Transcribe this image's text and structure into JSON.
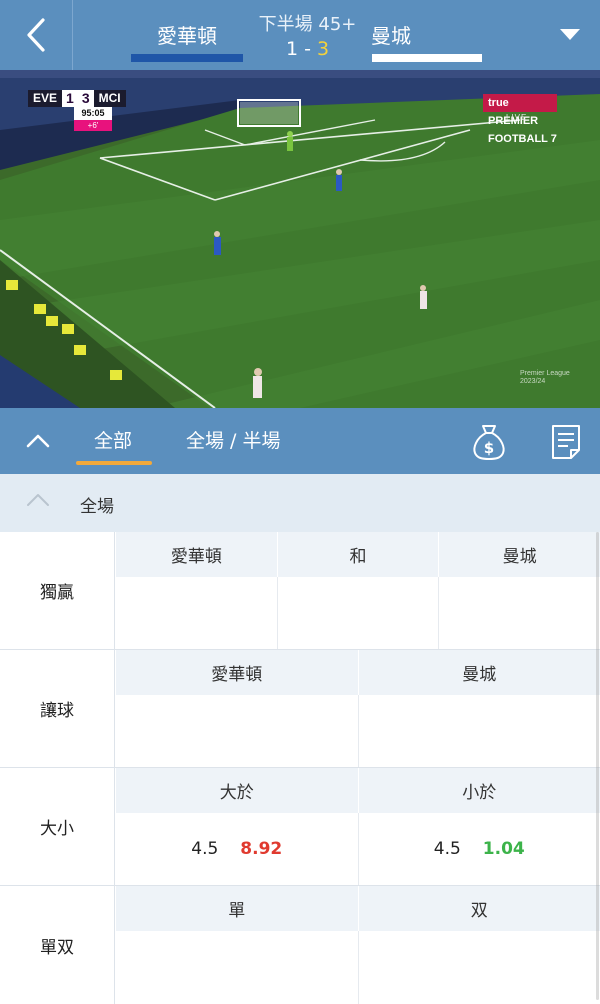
{
  "header": {
    "home_team": "愛華頓",
    "away_team": "曼城",
    "period": "下半場 45+",
    "home_score": "1",
    "score_sep": " - ",
    "away_score": "3",
    "home_color": "#1f56a8",
    "away_color": "#ffffff"
  },
  "video": {
    "home_abbr": "EVE",
    "away_abbr": "MCI",
    "home_goals": "1",
    "away_goals": "3",
    "clock": "95:05",
    "added_time": "+6'",
    "broadcaster": "true PREMIER FOOTBALL 7",
    "live": "LIVE",
    "watermark_line1": "Premier League",
    "watermark_line2": "2023/24"
  },
  "tabs": {
    "all": "全部",
    "full_half": "全場 / 半場",
    "active": "all"
  },
  "section": {
    "title": "全場"
  },
  "markets": [
    {
      "label": "獨贏",
      "headers": [
        "愛華頓",
        "和",
        "曼城"
      ],
      "cells": [
        {
          "line": "",
          "odds": ""
        },
        {
          "line": "",
          "odds": ""
        },
        {
          "line": "",
          "odds": ""
        }
      ]
    },
    {
      "label": "讓球",
      "headers": [
        "愛華頓",
        "曼城"
      ],
      "cells": [
        {
          "line": "",
          "odds": ""
        },
        {
          "line": "",
          "odds": ""
        }
      ]
    },
    {
      "label": "大小",
      "headers": [
        "大於",
        "小於"
      ],
      "cells": [
        {
          "line": "4.5",
          "odds": "8.92",
          "odds_color": "red"
        },
        {
          "line": "4.5",
          "odds": "1.04",
          "odds_color": "green"
        }
      ]
    },
    {
      "label": "單双",
      "headers": [
        "單",
        "双"
      ],
      "cells": [
        {
          "line": "",
          "odds": ""
        },
        {
          "line": "",
          "odds": ""
        }
      ]
    }
  ],
  "icons": {
    "back": "chevron-left-icon",
    "dropdown": "caret-down-icon",
    "collapse": "chevron-up-icon",
    "money": "money-bag-icon",
    "notes": "notes-icon"
  }
}
